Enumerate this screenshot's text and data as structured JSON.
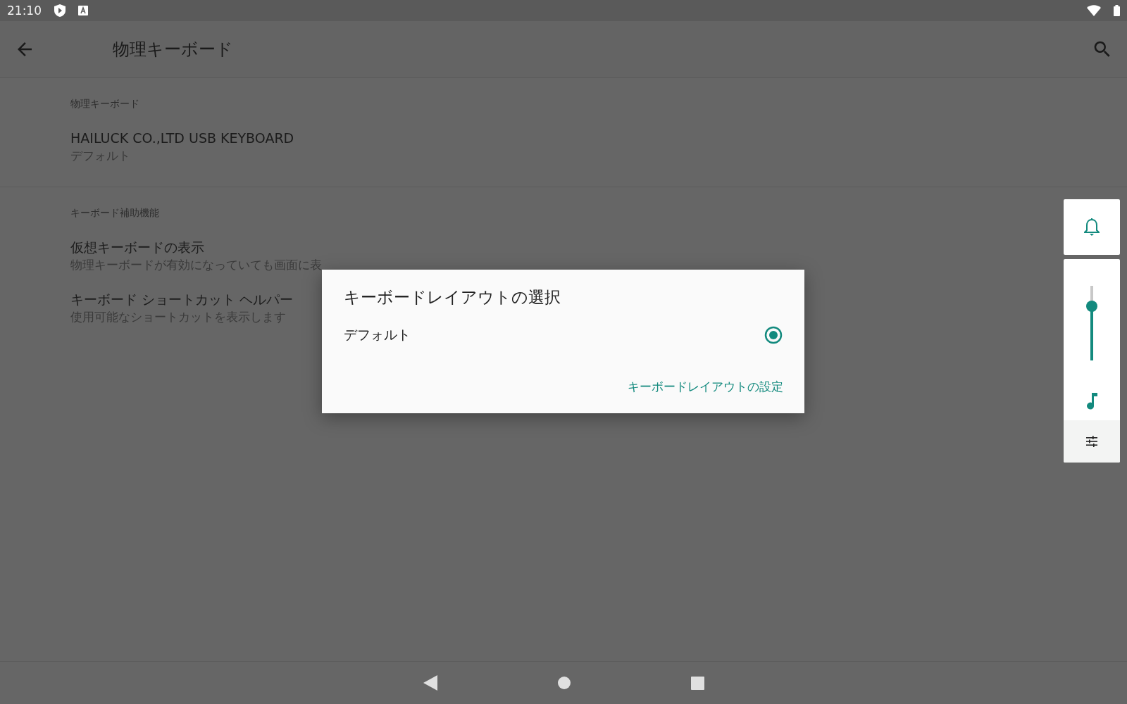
{
  "status_bar": {
    "time": "21:10"
  },
  "app_bar": {
    "title": "物理キーボード"
  },
  "sections": [
    {
      "header": "物理キーボード",
      "items": [
        {
          "title": "HAILUCK CO.,LTD USB KEYBOARD",
          "summary": "デフォルト"
        }
      ]
    },
    {
      "header": "キーボード補助機能",
      "items": [
        {
          "title": "仮想キーボードの表示",
          "summary": "物理キーボードが有効になっていても画面に表"
        },
        {
          "title": "キーボード ショートカット ヘルパー",
          "summary": "使用可能なショートカットを表示します"
        }
      ]
    }
  ],
  "dialog": {
    "title": "キーボードレイアウトの選択",
    "options": [
      {
        "label": "デフォルト",
        "selected": true
      }
    ],
    "action": "キーボードレイアウトの設定"
  },
  "volume_panel": {
    "level": 0.73
  }
}
